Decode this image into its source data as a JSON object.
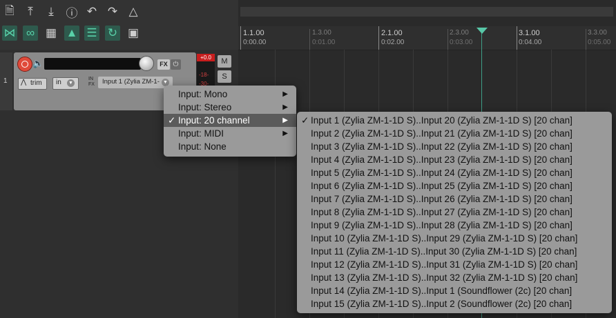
{
  "toolbar": {
    "row1_icons": [
      "new-file-icon",
      "save-upload-icon",
      "download-icon",
      "info-icon",
      "undo-icon",
      "redo-icon",
      "metronome-icon"
    ],
    "row2_icons": [
      "crossfade-icon",
      "link-icon",
      "grid-icon",
      "snap-icon",
      "grid-lines-icon",
      "loop-icon",
      "lock-icon"
    ]
  },
  "ruler": {
    "marks": [
      {
        "measure": "1.1.00",
        "time": "0:00.00",
        "major": true
      },
      {
        "measure": "1.3.00",
        "time": "0:01.00",
        "major": false
      },
      {
        "measure": "2.1.00",
        "time": "0:02.00",
        "major": true
      },
      {
        "measure": "2.3.00",
        "time": "0:03.00",
        "major": false
      },
      {
        "measure": "3.1.00",
        "time": "0:04.00",
        "major": true
      },
      {
        "measure": "3.3.00",
        "time": "0:05.00",
        "major": false
      }
    ]
  },
  "track": {
    "number": "1",
    "trim_label": "trim",
    "in_label": "in",
    "infx_label": "IN FX",
    "fx_label": "FX",
    "input_label": "Input 1 (Zylia ZM-1-",
    "meter_peak": "+0.0",
    "meter_labels": [
      "-18-",
      "-30-"
    ],
    "mute_label": "M",
    "solo_label": "S"
  },
  "input_menu": {
    "items": [
      {
        "label": "Input: Mono",
        "submenu": true,
        "checked": false
      },
      {
        "label": "Input: Stereo",
        "submenu": true,
        "checked": false
      },
      {
        "label": "Input: 20 channel",
        "submenu": true,
        "checked": true
      },
      {
        "label": "Input: MIDI",
        "submenu": true,
        "checked": false
      },
      {
        "label": "Input: None",
        "submenu": false,
        "checked": false
      }
    ]
  },
  "submenu": {
    "items": [
      {
        "label": "Input 1 (Zylia ZM-1-1D S)..Input 20 (Zylia ZM-1-1D S) [20 chan]",
        "checked": true
      },
      {
        "label": "Input 2 (Zylia ZM-1-1D S)..Input 21 (Zylia ZM-1-1D S) [20 chan]",
        "checked": false
      },
      {
        "label": "Input 3 (Zylia ZM-1-1D S)..Input 22 (Zylia ZM-1-1D S) [20 chan]",
        "checked": false
      },
      {
        "label": "Input 4 (Zylia ZM-1-1D S)..Input 23 (Zylia ZM-1-1D S) [20 chan]",
        "checked": false
      },
      {
        "label": "Input 5 (Zylia ZM-1-1D S)..Input 24 (Zylia ZM-1-1D S) [20 chan]",
        "checked": false
      },
      {
        "label": "Input 6 (Zylia ZM-1-1D S)..Input 25 (Zylia ZM-1-1D S) [20 chan]",
        "checked": false
      },
      {
        "label": "Input 7 (Zylia ZM-1-1D S)..Input 26 (Zylia ZM-1-1D S) [20 chan]",
        "checked": false
      },
      {
        "label": "Input 8 (Zylia ZM-1-1D S)..Input 27 (Zylia ZM-1-1D S) [20 chan]",
        "checked": false
      },
      {
        "label": "Input 9 (Zylia ZM-1-1D S)..Input 28 (Zylia ZM-1-1D S) [20 chan]",
        "checked": false
      },
      {
        "label": "Input 10 (Zylia ZM-1-1D S)..Input 29 (Zylia ZM-1-1D S) [20 chan]",
        "checked": false
      },
      {
        "label": "Input 11 (Zylia ZM-1-1D S)..Input 30 (Zylia ZM-1-1D S) [20 chan]",
        "checked": false
      },
      {
        "label": "Input 12 (Zylia ZM-1-1D S)..Input 31 (Zylia ZM-1-1D S) [20 chan]",
        "checked": false
      },
      {
        "label": "Input 13 (Zylia ZM-1-1D S)..Input 32 (Zylia ZM-1-1D S) [20 chan]",
        "checked": false
      },
      {
        "label": "Input 14 (Zylia ZM-1-1D S)..Input 1 (Soundflower (2c) [20 chan]",
        "checked": false
      },
      {
        "label": "Input 15 (Zylia ZM-1-1D S)..Input 2 (Soundflower (2c) [20 chan]",
        "checked": false
      }
    ]
  },
  "colors": {
    "accent_green": "#58c8a8",
    "record_red": "#e04a3a",
    "menu_bg": "#9a9a9a",
    "menu_selected": "#5b5b5b"
  }
}
